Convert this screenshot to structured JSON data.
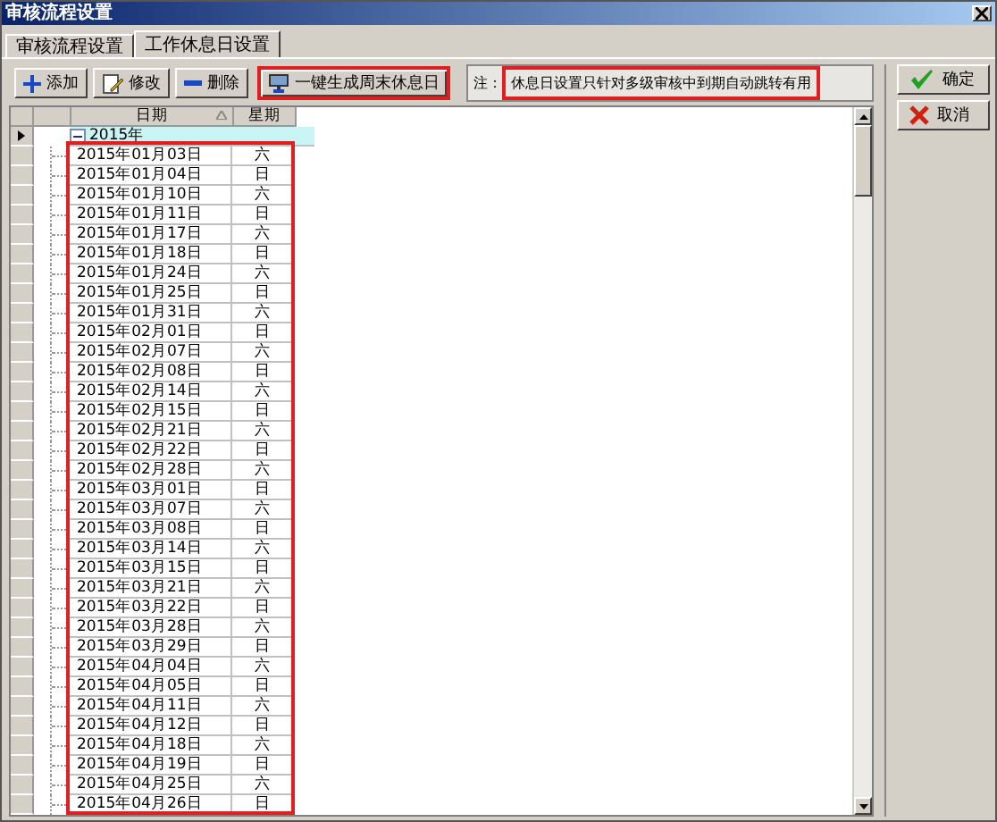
{
  "window": {
    "title": "审核流程设置"
  },
  "tabs": [
    {
      "label": "审核流程设置",
      "selected": false
    },
    {
      "label": "工作休息日设置",
      "selected": true
    }
  ],
  "toolbar": [
    {
      "label": "添加",
      "kind": "add",
      "highlighted": false
    },
    {
      "label": "修改",
      "kind": "edit",
      "highlighted": false
    },
    {
      "label": "删除",
      "kind": "delete",
      "highlighted": false
    },
    {
      "label": "一键生成周末休息日",
      "kind": "generate",
      "highlighted": true
    }
  ],
  "note": {
    "label": "注：",
    "text": "休息日设置只针对多级审核中到期自动跳转有用",
    "highlighted": true
  },
  "side_buttons": [
    {
      "label": "确定",
      "kind": "ok"
    },
    {
      "label": "取消",
      "kind": "cancel"
    }
  ],
  "grid": {
    "columns": [
      {
        "label": "日期",
        "sorted": true
      },
      {
        "label": "星期",
        "sorted": false
      }
    ],
    "group": {
      "label": "2015年",
      "expanded": true,
      "current": true,
      "rows_highlighted": true,
      "rows": [
        {
          "date": "2015年01月03日",
          "weekday": "六"
        },
        {
          "date": "2015年01月04日",
          "weekday": "日"
        },
        {
          "date": "2015年01月10日",
          "weekday": "六"
        },
        {
          "date": "2015年01月11日",
          "weekday": "日"
        },
        {
          "date": "2015年01月17日",
          "weekday": "六"
        },
        {
          "date": "2015年01月18日",
          "weekday": "日"
        },
        {
          "date": "2015年01月24日",
          "weekday": "六"
        },
        {
          "date": "2015年01月25日",
          "weekday": "日"
        },
        {
          "date": "2015年01月31日",
          "weekday": "六"
        },
        {
          "date": "2015年02月01日",
          "weekday": "日"
        },
        {
          "date": "2015年02月07日",
          "weekday": "六"
        },
        {
          "date": "2015年02月08日",
          "weekday": "日"
        },
        {
          "date": "2015年02月14日",
          "weekday": "六"
        },
        {
          "date": "2015年02月15日",
          "weekday": "日"
        },
        {
          "date": "2015年02月21日",
          "weekday": "六"
        },
        {
          "date": "2015年02月22日",
          "weekday": "日"
        },
        {
          "date": "2015年02月28日",
          "weekday": "六"
        },
        {
          "date": "2015年03月01日",
          "weekday": "日"
        },
        {
          "date": "2015年03月07日",
          "weekday": "六"
        },
        {
          "date": "2015年03月08日",
          "weekday": "日"
        },
        {
          "date": "2015年03月14日",
          "weekday": "六"
        },
        {
          "date": "2015年03月15日",
          "weekday": "日"
        },
        {
          "date": "2015年03月21日",
          "weekday": "六"
        },
        {
          "date": "2015年03月22日",
          "weekday": "日"
        },
        {
          "date": "2015年03月28日",
          "weekday": "六"
        },
        {
          "date": "2015年03月29日",
          "weekday": "日"
        },
        {
          "date": "2015年04月04日",
          "weekday": "六"
        },
        {
          "date": "2015年04月05日",
          "weekday": "日"
        },
        {
          "date": "2015年04月11日",
          "weekday": "六"
        },
        {
          "date": "2015年04月12日",
          "weekday": "日"
        },
        {
          "date": "2015年04月18日",
          "weekday": "六"
        },
        {
          "date": "2015年04月19日",
          "weekday": "日"
        },
        {
          "date": "2015年04月25日",
          "weekday": "六"
        },
        {
          "date": "2015年04月26日",
          "weekday": "日"
        }
      ]
    }
  }
}
